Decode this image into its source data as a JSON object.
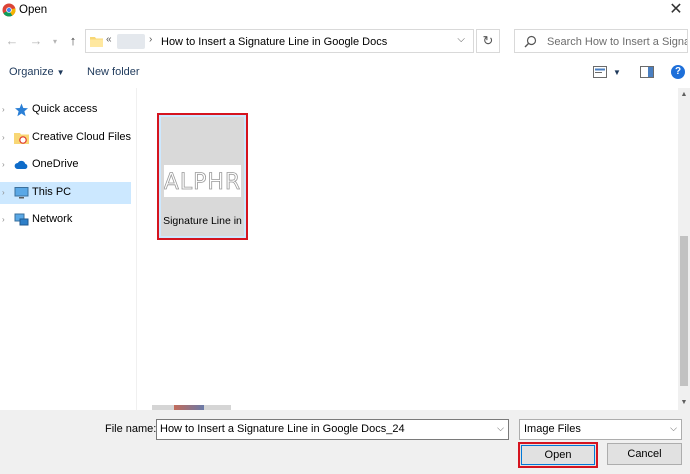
{
  "window": {
    "title": "Open"
  },
  "address": {
    "overflow": "«",
    "path": "How to Insert a Signature Line in Google Docs"
  },
  "search": {
    "placeholder": "Search How to Insert a Signa..."
  },
  "toolbar": {
    "organize": "Organize",
    "new_folder": "New folder"
  },
  "sidebar": {
    "items": [
      {
        "label": "Quick access",
        "icon": "star-icon"
      },
      {
        "label": "Creative Cloud Files",
        "icon": "creative-cloud-folder-icon"
      },
      {
        "label": "OneDrive",
        "icon": "cloud-icon"
      },
      {
        "label": "This PC",
        "icon": "computer-icon",
        "selected": true
      },
      {
        "label": "Network",
        "icon": "network-icon"
      }
    ]
  },
  "files": [
    {
      "name": "Signature Line in",
      "thumbnail_text": "ALPHR",
      "selected": true
    }
  ],
  "bottom": {
    "file_name_label": "File name:",
    "file_name_value": "How to Insert a Signature Line in Google Docs_24",
    "file_type": "Image Files",
    "open_label": "Open",
    "cancel_label": "Cancel"
  },
  "colors": {
    "selection": "#cce8ff",
    "highlight_box": "#d5141f",
    "toolbar_text": "#1e395b"
  }
}
